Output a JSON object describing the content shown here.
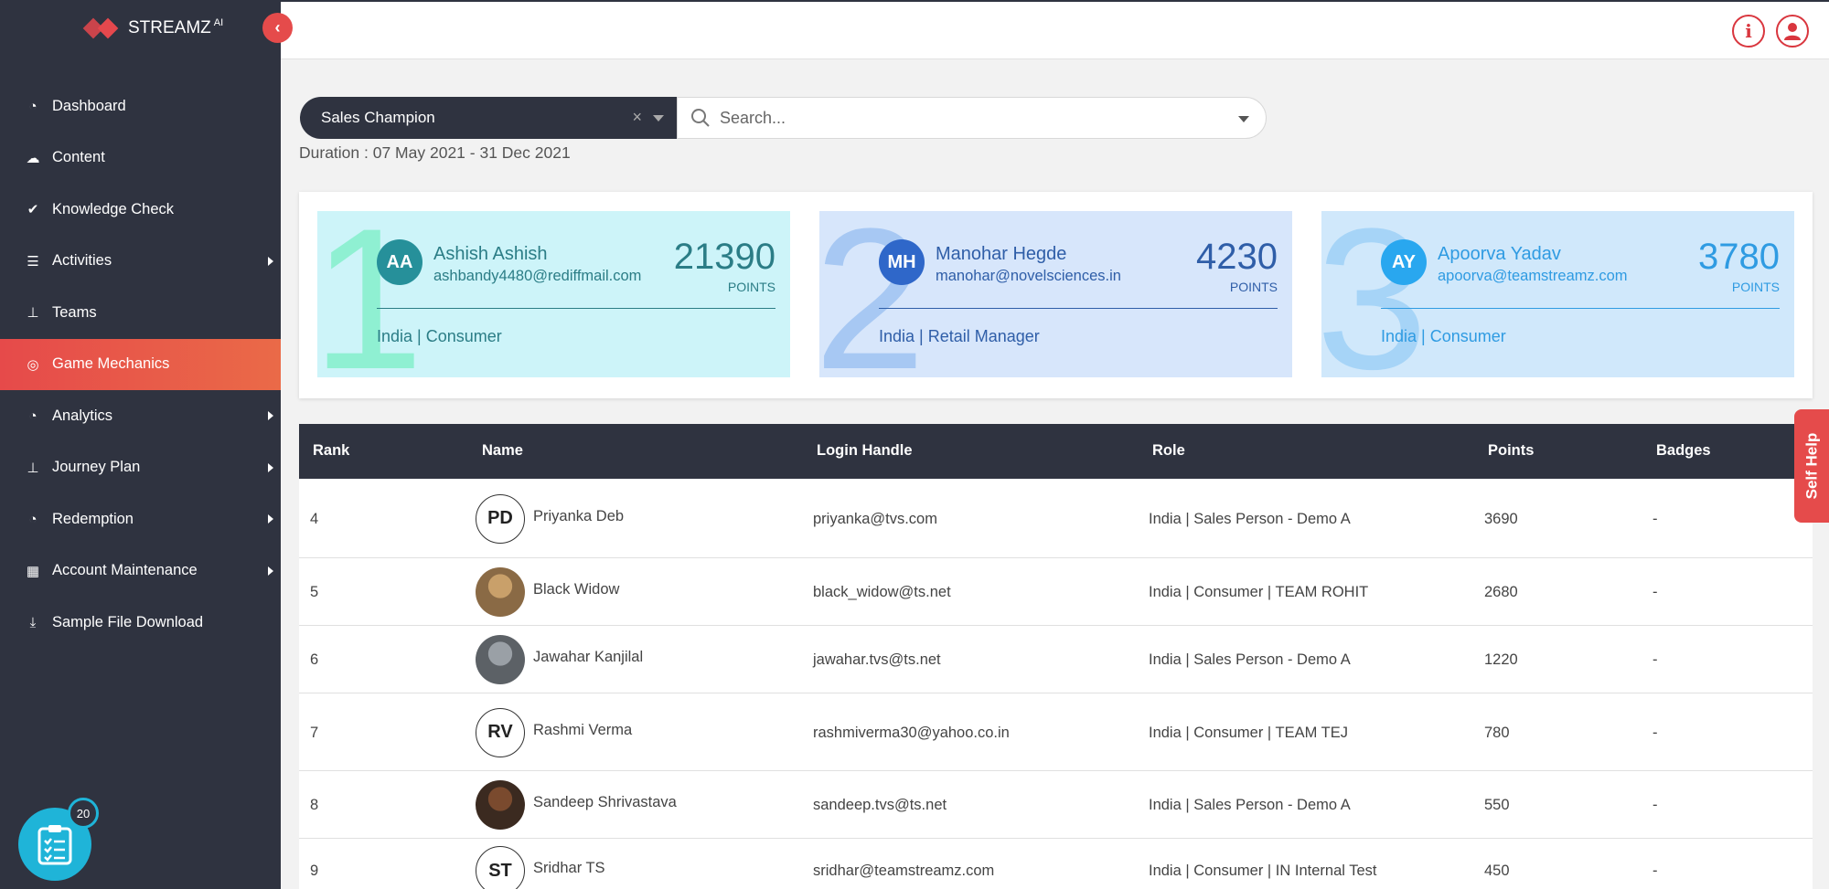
{
  "app": {
    "brand": "STREAMZ",
    "brand_sup": "AI"
  },
  "sidebar": {
    "items": [
      {
        "label": "Dashboard",
        "icon": "dashboard-icon",
        "has_submenu": false
      },
      {
        "label": "Content",
        "icon": "cloud-upload-icon",
        "has_submenu": false
      },
      {
        "label": "Knowledge Check",
        "icon": "check-icon",
        "has_submenu": false
      },
      {
        "label": "Activities",
        "icon": "list-icon",
        "has_submenu": true
      },
      {
        "label": "Teams",
        "icon": "sitemap-icon",
        "has_submenu": false
      },
      {
        "label": "Game Mechanics",
        "icon": "target-icon",
        "has_submenu": false,
        "active": true
      },
      {
        "label": "Analytics",
        "icon": "dashboard-icon",
        "has_submenu": true
      },
      {
        "label": "Journey Plan",
        "icon": "sitemap-icon",
        "has_submenu": true
      },
      {
        "label": "Redemption",
        "icon": "dashboard-icon",
        "has_submenu": true
      },
      {
        "label": "Account Maintenance",
        "icon": "grid-icon",
        "has_submenu": true
      },
      {
        "label": "Sample File Download",
        "icon": "download-icon",
        "has_submenu": false
      }
    ],
    "task_badge": "20"
  },
  "filters": {
    "selected": "Sales Champion",
    "search_placeholder": "Search...",
    "duration": "Duration : 07 May 2021 - 31 Dec 2021"
  },
  "podium": [
    {
      "rank": "1",
      "initials": "AA",
      "name": "Ashish Ashish",
      "email": "ashbandy4480@rediffmail.com",
      "points": "21390",
      "points_label": "POINTS",
      "role": "India | Consumer"
    },
    {
      "rank": "2",
      "initials": "MH",
      "name": "Manohar Hegde",
      "email": "manohar@novelsciences.in",
      "points": "4230",
      "points_label": "POINTS",
      "role": "India | Retail Manager"
    },
    {
      "rank": "3",
      "initials": "AY",
      "name": "Apoorva Yadav",
      "email": "apoorva@teamstreamz.com",
      "points": "3780",
      "points_label": "POINTS",
      "role": "India | Consumer"
    }
  ],
  "table": {
    "headers": {
      "rank": "Rank",
      "name": "Name",
      "login": "Login Handle",
      "role": "Role",
      "points": "Points",
      "badges": "Badges"
    },
    "rows": [
      {
        "rank": "4",
        "initials": "PD",
        "photo": false,
        "name": "Priyanka Deb",
        "login": "priyanka@tvs.com",
        "role": "India | Sales Person - Demo A",
        "points": "3690",
        "badges": "-"
      },
      {
        "rank": "5",
        "initials": "",
        "photo": true,
        "name": "Black Widow",
        "login": "black_widow@ts.net",
        "role": "India | Consumer | TEAM ROHIT",
        "points": "2680",
        "badges": "-"
      },
      {
        "rank": "6",
        "initials": "",
        "photo": true,
        "name": "Jawahar Kanjilal",
        "login": "jawahar.tvs@ts.net",
        "role": "India | Sales Person - Demo A",
        "points": "1220",
        "badges": "-"
      },
      {
        "rank": "7",
        "initials": "RV",
        "photo": false,
        "name": "Rashmi Verma",
        "login": "rashmiverma30@yahoo.co.in",
        "role": "India | Consumer | TEAM TEJ",
        "points": "780",
        "badges": "-"
      },
      {
        "rank": "8",
        "initials": "",
        "photo": true,
        "name": "Sandeep Shrivastava",
        "login": "sandeep.tvs@ts.net",
        "role": "India | Sales Person - Demo A",
        "points": "550",
        "badges": "-"
      },
      {
        "rank": "9",
        "initials": "ST",
        "photo": false,
        "name": "Sridhar TS",
        "login": "sridhar@teamstreamz.com",
        "role": "India | Consumer | IN Internal Test",
        "points": "450",
        "badges": "-"
      }
    ]
  },
  "self_help": "Self Help"
}
